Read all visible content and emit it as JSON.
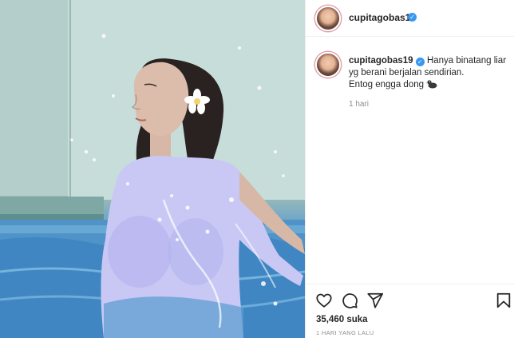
{
  "post": {
    "username": "cupitagobas19",
    "verified_mark": "✓",
    "caption": {
      "line1": "Hanya binatang liar yg berani berjalan sendirian.",
      "line2": "Entog engga dong"
    },
    "caption_time": "1 hari",
    "likes": "35,460 suka",
    "date": "1 HARI YANG LALU"
  },
  "icons": {
    "like": "heart-icon",
    "comment": "comment-icon",
    "share": "share-icon",
    "save": "bookmark-icon",
    "emoji": "duck-emoji-icon"
  },
  "colors": {
    "verified": "#3897f0",
    "text": "#262626",
    "muted": "#8e8e8e",
    "border": "#efefef",
    "pool_water": "#5d9ed3",
    "shirt": "#c9c8f4"
  }
}
